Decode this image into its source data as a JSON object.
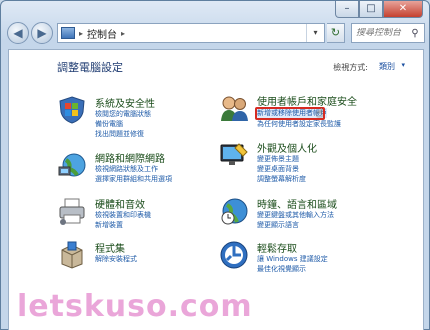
{
  "window": {
    "caption": {
      "minimize": "–",
      "maximize": "□",
      "close": "✕"
    }
  },
  "nav": {
    "back": "◀",
    "forward": "▶",
    "address": {
      "separator": "▸",
      "location": "控制台",
      "dropdown": "▾"
    },
    "refresh": "↻",
    "search": {
      "placeholder": "搜尋控制台",
      "icon": "search-icon"
    }
  },
  "content": {
    "title": "調整電腦設定",
    "view_by": {
      "label": "檢視方式:",
      "value": "類別",
      "arrow": "▾"
    },
    "categories": [
      {
        "heading": "系統及安全性",
        "icon": "shield-flag-icon",
        "links": [
          "檢閱您的電腦狀態",
          "備份電腦",
          "找出問題並修復"
        ]
      },
      {
        "heading": "網路和網際網路",
        "icon": "network-globe-icon",
        "links": [
          "檢視網路狀態及工作",
          "選擇家用群組和共用選項"
        ]
      },
      {
        "heading": "硬體和音效",
        "icon": "printer-icon",
        "links": [
          "檢視裝置和印表機",
          "新增裝置"
        ]
      },
      {
        "heading": "程式集",
        "icon": "programs-box-icon",
        "links": [
          "解除安裝程式"
        ]
      },
      {
        "heading": "使用者帳戶和家庭安全",
        "icon": "users-icon",
        "links": [
          "新增或移除使用者帳戶",
          "為任何使用者設定家長監護"
        ]
      },
      {
        "heading": "外觀及個人化",
        "icon": "display-paint-icon",
        "links": [
          "變更佈景主題",
          "變更桌面背景",
          "調整螢幕解析度"
        ]
      },
      {
        "heading": "時鐘、語言和區域",
        "icon": "clock-globe-icon",
        "links": [
          "變更鍵盤或其他輸入方法",
          "變更顯示語言"
        ]
      },
      {
        "heading": "輕鬆存取",
        "icon": "ease-of-access-icon",
        "links": [
          "讓 Windows 建議設定",
          "最佳化視覺顯示"
        ]
      }
    ]
  },
  "watermark": "letskuso.com"
}
